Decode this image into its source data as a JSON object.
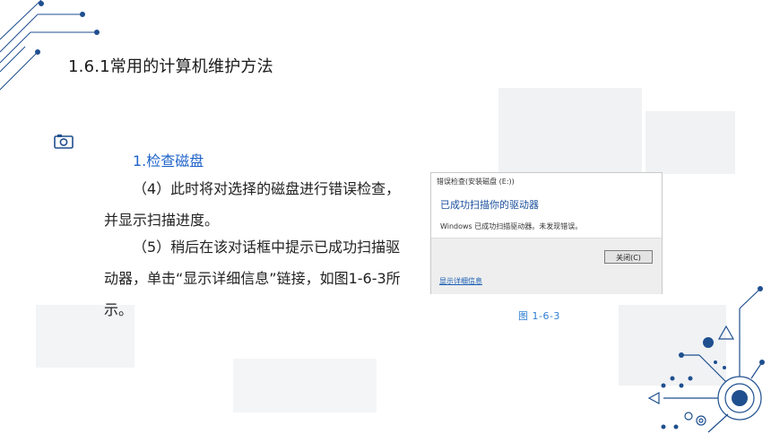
{
  "page": {
    "title": "1.6.1常用的计算机维护方法",
    "section_heading": "1.检查磁盘",
    "paragraphs": [
      "（4）此时将对选择的磁盘进行错误检查，并显示扫描进度。",
      "（5）稍后在该对话框中提示已成功扫描驱动器，单击“显示详细信息”链接，如图1-6-3所示。"
    ]
  },
  "figure": {
    "dialog_title": "错误检查(安装磁盘 (E:))",
    "heading": "已成功扫描你的驱动器",
    "message": "Windows 已成功扫描驱动器。未发现错误。",
    "close_label": "关闭(C)",
    "details_link": "显示详细信息",
    "caption": "图 1-6-3"
  },
  "icons": {
    "camera": "camera-icon",
    "circuit": "circuit-decoration-icon"
  },
  "colors": {
    "accent": "#1e63c9",
    "decoration": "#1f4f8f"
  }
}
